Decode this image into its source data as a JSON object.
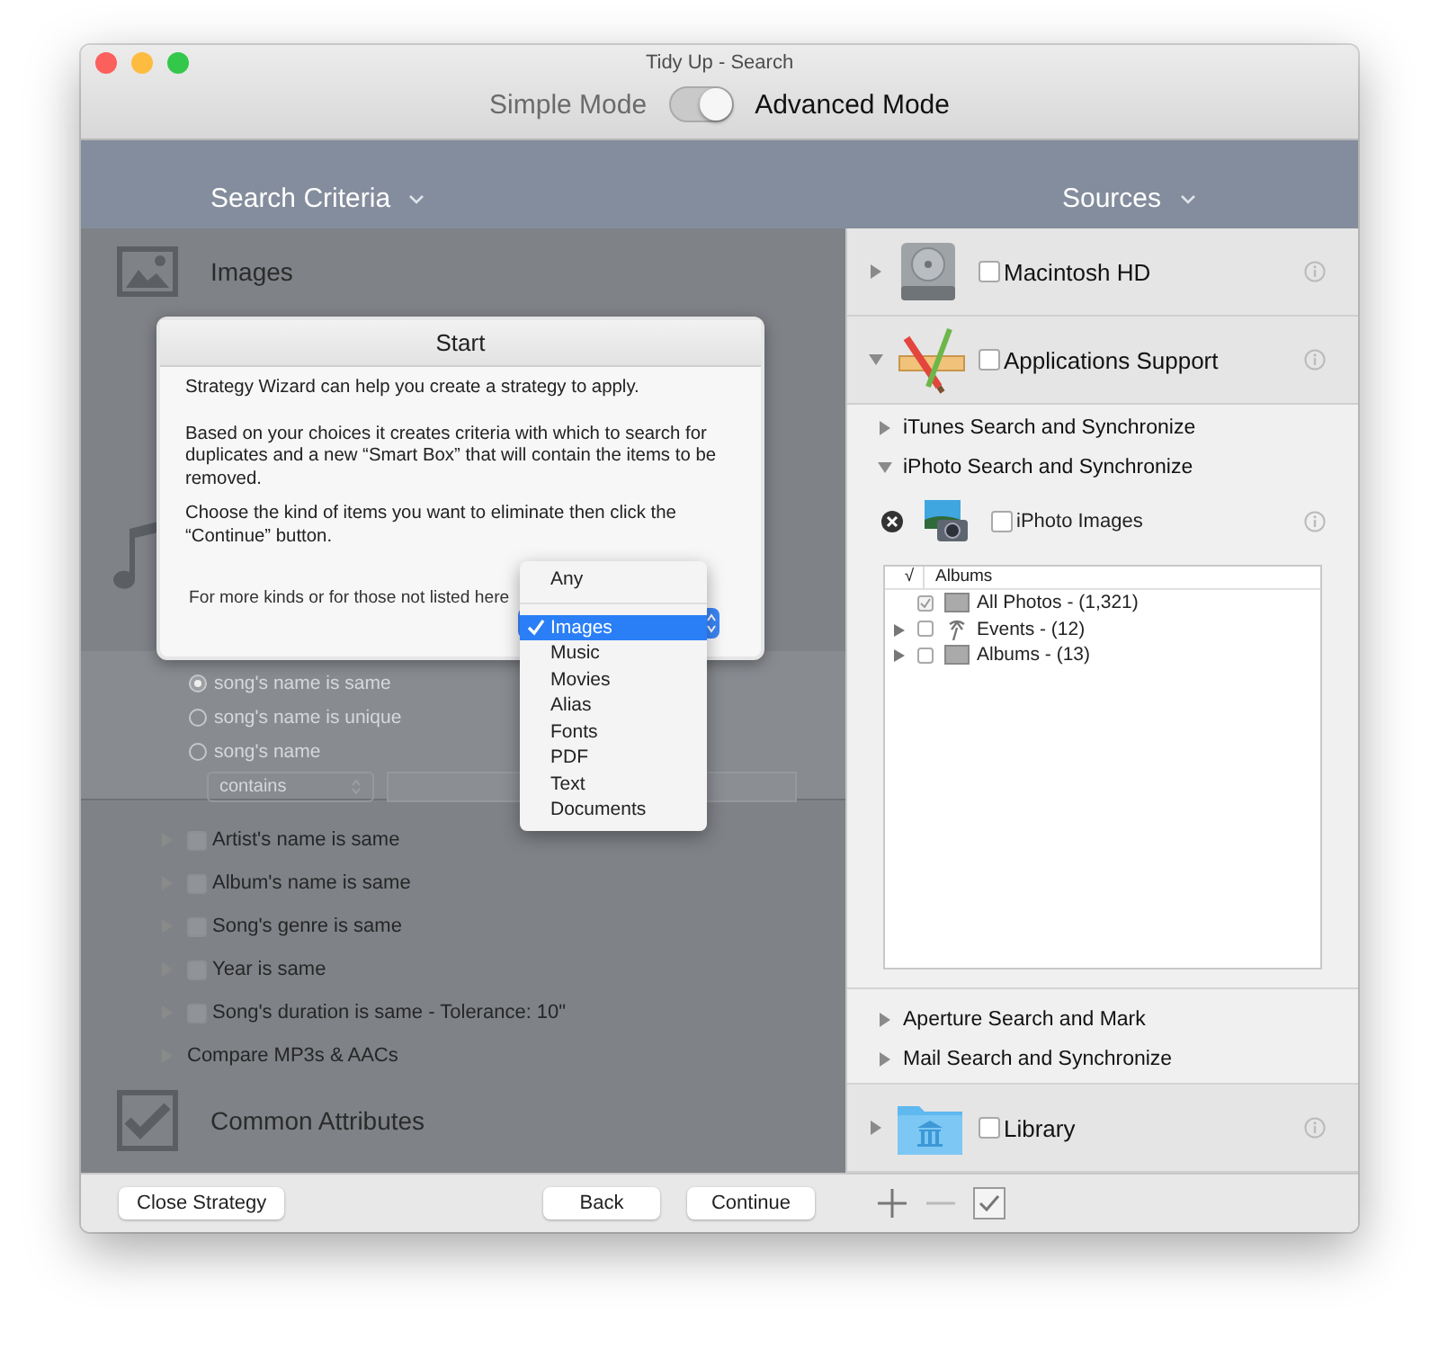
{
  "window": {
    "title": "Tidy Up - Search"
  },
  "mode_switch": {
    "left_label": "Simple Mode",
    "right_label": "Advanced Mode",
    "on": true
  },
  "criteria": {
    "header": "Search Criteria",
    "images_section": {
      "title": "Images"
    },
    "song_name_options": [
      {
        "label": "song's name is same",
        "selected": true
      },
      {
        "label": "song's name is unique",
        "selected": false
      },
      {
        "label": "song's name",
        "selected": false
      }
    ],
    "filter": {
      "operator": "contains"
    },
    "rows": [
      {
        "kind": "checkbox",
        "label": "Artist's name is same",
        "checked": false
      },
      {
        "kind": "checkbox",
        "label": "Album's name is same",
        "checked": false
      },
      {
        "kind": "checkbox",
        "label": "Song's genre is same",
        "checked": false
      },
      {
        "kind": "checkbox",
        "label": "Year is same",
        "checked": false
      },
      {
        "kind": "checkbox",
        "label": "Song's duration is same - Tolerance: 10\"",
        "checked": false
      },
      {
        "kind": "group",
        "label": "Compare MP3s & AACs"
      }
    ],
    "common_section": {
      "title": "Common Attributes"
    }
  },
  "wizard": {
    "title": "Start",
    "paragraphs": [
      "Strategy Wizard can help you create a strategy to apply.",
      "Based on your choices it creates criteria with which to search for duplicates and a new “Smart Box” that will contain the items to be removed.",
      "Choose the kind of items you want to eliminate then click the “Continue” button."
    ],
    "footer": "For more kinds or for those not listed here"
  },
  "kind_menu": {
    "items": [
      {
        "kind": "item",
        "label": "Any",
        "selected": false
      },
      {
        "kind": "separator"
      },
      {
        "kind": "item",
        "label": "Images",
        "selected": true
      },
      {
        "kind": "item",
        "label": "Music",
        "selected": false
      },
      {
        "kind": "item",
        "label": "Movies",
        "selected": false
      },
      {
        "kind": "item",
        "label": "Alias",
        "selected": false
      },
      {
        "kind": "item",
        "label": "Fonts",
        "selected": false
      },
      {
        "kind": "item",
        "label": "PDF",
        "selected": false
      },
      {
        "kind": "item",
        "label": "Text",
        "selected": false
      },
      {
        "kind": "item",
        "label": "Documents",
        "selected": false
      }
    ]
  },
  "sources": {
    "header": "Sources",
    "items": [
      {
        "kind": "disk",
        "name": "Macintosh HD",
        "expanded": false,
        "checked": false
      },
      {
        "kind": "apps",
        "name": "Applications Support",
        "expanded": true,
        "checked": false,
        "children": [
          {
            "name": "iTunes Search and Synchronize",
            "expanded": false
          },
          {
            "name": "iPhoto Search and Synchronize",
            "expanded": true,
            "library": {
              "name": "iPhoto Images",
              "checked": false,
              "columns": [
                "√",
                "Albums"
              ],
              "albums": [
                {
                  "kind": "photos",
                  "name": "All Photos - (1,321)",
                  "checked": true,
                  "expandable": false
                },
                {
                  "kind": "events",
                  "name": "Events - (12)",
                  "checked": false,
                  "expandable": true
                },
                {
                  "kind": "albums",
                  "name": "Albums - (13)",
                  "checked": false,
                  "expandable": true
                }
              ]
            }
          },
          {
            "name": "Aperture Search and Mark",
            "expanded": false
          },
          {
            "name": "Mail Search and Synchronize",
            "expanded": false
          }
        ]
      },
      {
        "kind": "folder",
        "name": "Library",
        "expanded": false,
        "checked": false
      }
    ]
  },
  "footer": {
    "left_button": "Close Strategy",
    "nav_buttons": [
      "Back",
      "Continue"
    ]
  }
}
